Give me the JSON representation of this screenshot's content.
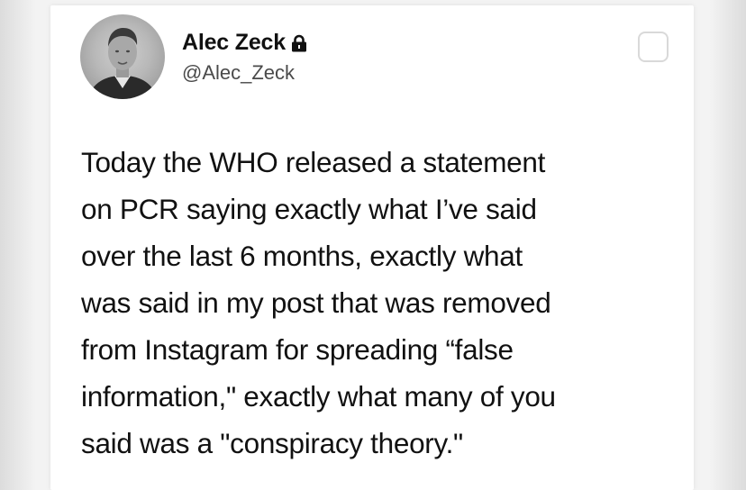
{
  "tweet": {
    "author": {
      "name": "Alec Zeck",
      "handle": "@Alec_Zeck",
      "protected_icon": "lock-icon",
      "avatar_icon": "profile-photo"
    },
    "corner_icon": "square-outline-icon",
    "text_lines": [
      "Today the WHO released a statement",
      "on PCR saying exactly what I’ve said",
      "over the last 6 months, exactly what",
      "was said in my post that was removed",
      "from Instagram for spreading “false",
      "information,\" exactly what many of you",
      "said was a \"conspiracy theory.\""
    ]
  },
  "colors": {
    "text": "#111111",
    "handle": "#4a4a4a",
    "background": "#ffffff"
  }
}
